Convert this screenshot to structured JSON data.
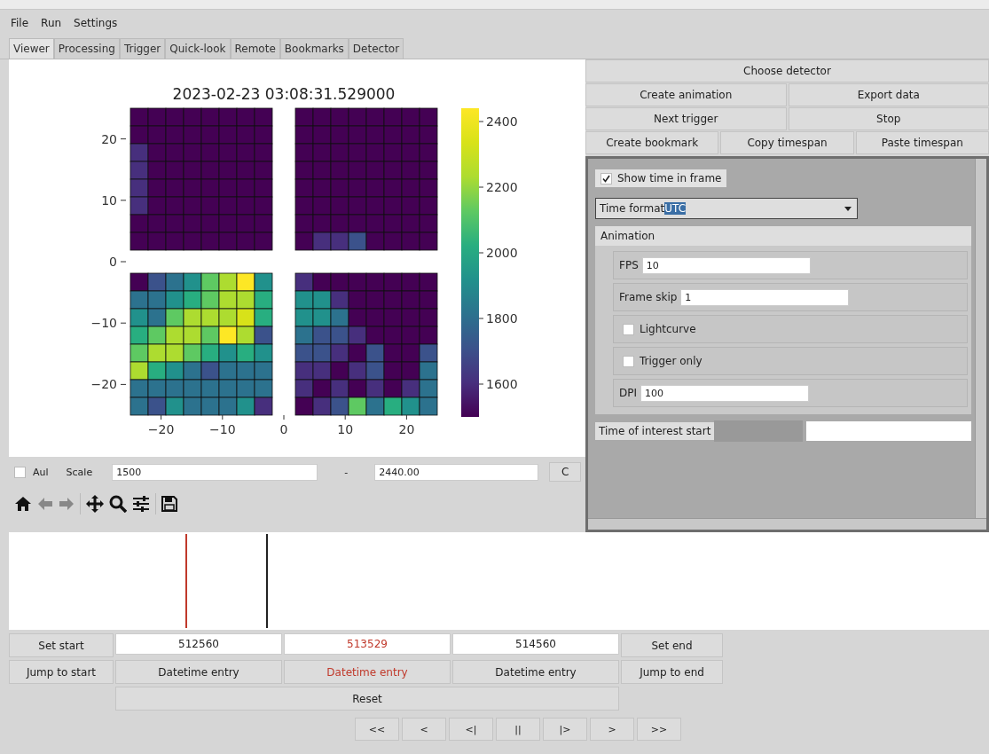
{
  "menu": [
    "File",
    "Run",
    "Settings"
  ],
  "tabs": [
    {
      "label": "Viewer",
      "selected": true
    },
    {
      "label": "Processing",
      "selected": false
    },
    {
      "label": "Trigger",
      "selected": false
    },
    {
      "label": "Quick-look",
      "selected": false
    },
    {
      "label": "Remote",
      "selected": false
    },
    {
      "label": "Bookmarks",
      "selected": false
    },
    {
      "label": "Detector",
      "selected": false
    }
  ],
  "plot": {
    "title": "2023-02-23 03:08:31.529000",
    "xticks": [
      "−20",
      "−10",
      "0",
      "10",
      "20"
    ],
    "yticks": [
      "20",
      "10",
      "0",
      "−10",
      "−20"
    ],
    "colorbar_ticks": [
      "2400",
      "2200",
      "2000",
      "1800",
      "1600"
    ]
  },
  "scale": {
    "auto": {
      "label": "Aul",
      "checked": false
    },
    "label": "Scale",
    "min": "1500",
    "separator": "-",
    "max": "2440.00",
    "button": "C"
  },
  "actions": [
    [
      "Choose detector"
    ],
    [
      "Create animation",
      "Export data"
    ],
    [
      "Next trigger",
      "Stop"
    ],
    [
      "Create bookmark",
      "Copy timespan",
      "Paste timespan"
    ]
  ],
  "settings": {
    "show_time": {
      "label": "Show time in frame",
      "checked": true
    },
    "time_format": {
      "label": "Time format",
      "value": "UTC"
    },
    "animation": {
      "title": "Animation",
      "fields": [
        {
          "kind": "input",
          "label": "FPS",
          "value": "10"
        },
        {
          "kind": "input",
          "label": "Frame skip",
          "value": "1"
        },
        {
          "kind": "checkbox",
          "label": "Lightcurve",
          "checked": false
        },
        {
          "kind": "checkbox",
          "label": "Trigger only",
          "checked": false
        },
        {
          "kind": "input",
          "label": "DPI",
          "value": "100"
        }
      ]
    },
    "time_of_interest_start": {
      "label": "Time of interest start"
    }
  },
  "timespan": {
    "set_start": "Set start",
    "jump_to_start": "Jump to start",
    "set_end": "Set end",
    "jump_to_end": "Jump to end",
    "reset": "Reset",
    "entries": [
      {
        "value": "512560",
        "datetime": "Datetime entry",
        "highlighted": false
      },
      {
        "value": "513529",
        "datetime": "Datetime entry",
        "highlighted": true
      },
      {
        "value": "514560",
        "datetime": "Datetime entry",
        "highlighted": false
      }
    ]
  },
  "playback": [
    "<<",
    "<",
    "<|",
    "||",
    "|>",
    ">",
    ">>"
  ]
}
